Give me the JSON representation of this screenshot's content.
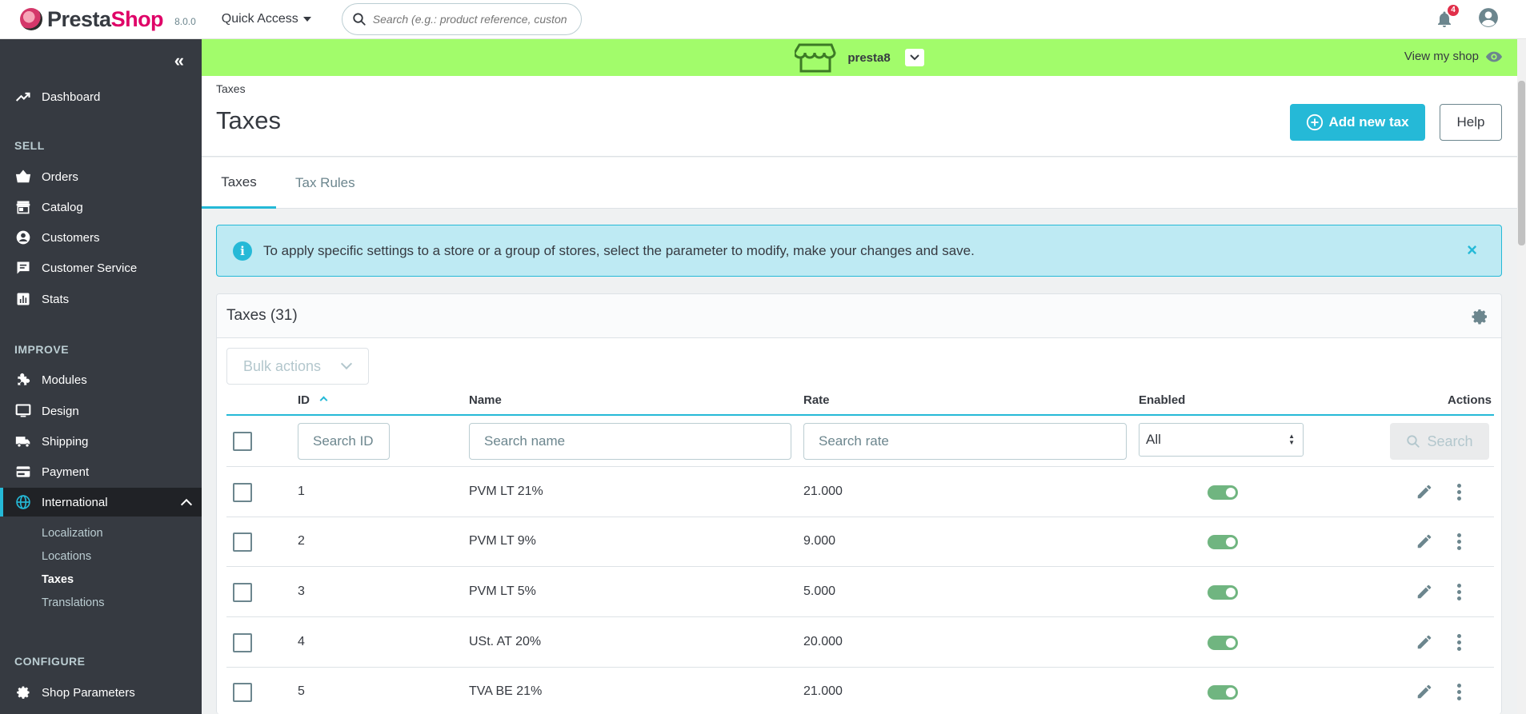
{
  "app": {
    "brand_presta": "Presta",
    "brand_shop": "Shop",
    "version": "8.0.0",
    "quick_access": "Quick Access",
    "search_placeholder": "Search (e.g.: product reference, custon",
    "notifications_count": "4",
    "colors": {
      "accent": "#25b9d7",
      "sidebar": "#363a41",
      "shopbar": "#a2fc6b",
      "brand": "#df0067",
      "toggle_on": "#70b580"
    }
  },
  "sidebar": {
    "dashboard": "Dashboard",
    "sections": {
      "sell": "SELL",
      "improve": "IMPROVE",
      "configure": "CONFIGURE"
    },
    "sell_items": [
      {
        "label": "Orders",
        "icon": "basket-icon"
      },
      {
        "label": "Catalog",
        "icon": "store-icon"
      },
      {
        "label": "Customers",
        "icon": "account-circle-icon"
      },
      {
        "label": "Customer Service",
        "icon": "chat-icon"
      },
      {
        "label": "Stats",
        "icon": "bar-chart-icon"
      }
    ],
    "improve_items": [
      {
        "label": "Modules",
        "icon": "puzzle-icon"
      },
      {
        "label": "Design",
        "icon": "desktop-icon"
      },
      {
        "label": "Shipping",
        "icon": "truck-icon"
      },
      {
        "label": "Payment",
        "icon": "credit-card-icon"
      },
      {
        "label": "International",
        "icon": "globe-icon"
      }
    ],
    "international_sub": [
      "Localization",
      "Locations",
      "Taxes",
      "Translations"
    ],
    "configure_items": [
      {
        "label": "Shop Parameters",
        "icon": "gear-icon"
      }
    ]
  },
  "shopbar": {
    "shop_name": "presta8",
    "view_my_shop": "View my shop"
  },
  "page": {
    "breadcrumb": "Taxes",
    "title": "Taxes",
    "add_button": "Add new tax",
    "help_button": "Help",
    "tabs": [
      "Taxes",
      "Tax Rules"
    ]
  },
  "alert": {
    "text": "To apply specific settings to a store or a group of stores, select the parameter to modify, make your changes and save."
  },
  "grid": {
    "title": "Taxes (31)",
    "bulk_actions": "Bulk actions",
    "columns": {
      "id": "ID",
      "name": "Name",
      "rate": "Rate",
      "enabled": "Enabled",
      "actions": "Actions"
    },
    "filters": {
      "id_placeholder": "Search ID",
      "name_placeholder": "Search name",
      "rate_placeholder": "Search rate",
      "enabled_value": "All",
      "search_button": "Search"
    },
    "rows": [
      {
        "id": "1",
        "name": "PVM LT 21%",
        "rate": "21.000",
        "enabled": true
      },
      {
        "id": "2",
        "name": "PVM LT 9%",
        "rate": "9.000",
        "enabled": true
      },
      {
        "id": "3",
        "name": "PVM LT 5%",
        "rate": "5.000",
        "enabled": true
      },
      {
        "id": "4",
        "name": "USt. AT 20%",
        "rate": "20.000",
        "enabled": true
      },
      {
        "id": "5",
        "name": "TVA BE 21%",
        "rate": "21.000",
        "enabled": true
      }
    ]
  }
}
